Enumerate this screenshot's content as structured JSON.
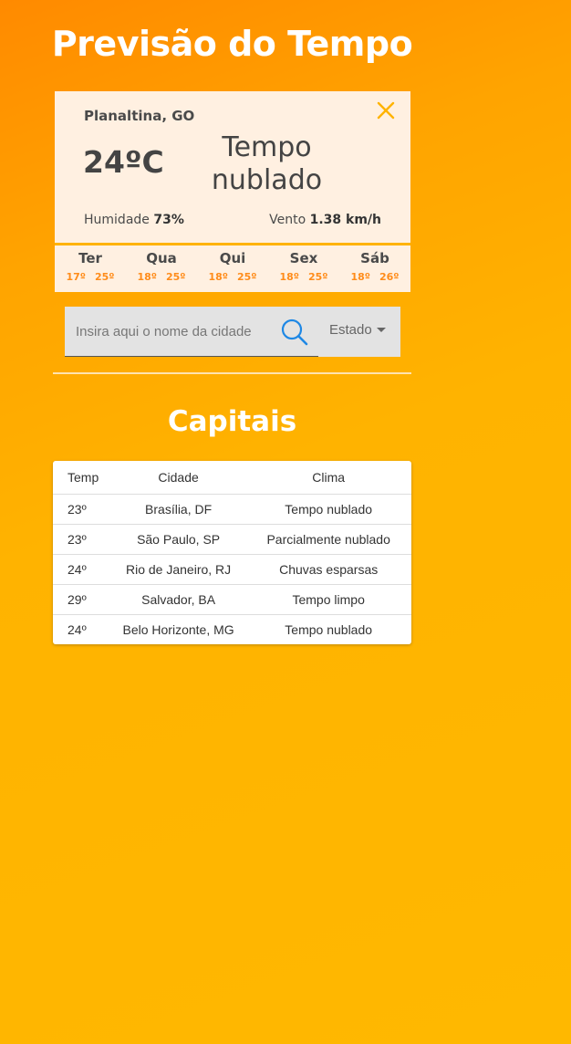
{
  "page": {
    "title": "Previsão do Tempo"
  },
  "weather": {
    "city": "Planaltina, GO",
    "temperature": "24ºC",
    "condition_line1": "Tempo",
    "condition_line2": "nublado",
    "humidity_label": "Humidade",
    "humidity_value": "73%",
    "wind_label": "Vento",
    "wind_value": "1.38 km/h",
    "forecast": [
      {
        "day": "Ter",
        "min": "17º",
        "max": "25º"
      },
      {
        "day": "Qua",
        "min": "18º",
        "max": "25º"
      },
      {
        "day": "Qui",
        "min": "18º",
        "max": "25º"
      },
      {
        "day": "Sex",
        "min": "18º",
        "max": "25º"
      },
      {
        "day": "Sáb",
        "min": "18º",
        "max": "26º"
      }
    ]
  },
  "search": {
    "placeholder": "Insira aqui o nome da cidade",
    "value": "",
    "state_label": "Estado"
  },
  "capitals": {
    "title": "Capitais",
    "headers": {
      "temp": "Temp",
      "city": "Cidade",
      "clima": "Clima"
    },
    "rows": [
      {
        "temp": "23º",
        "city": "Brasília, DF",
        "clima": "Tempo nublado"
      },
      {
        "temp": "23º",
        "city": "São Paulo, SP",
        "clima": "Parcialmente nublado"
      },
      {
        "temp": "24º",
        "city": "Rio de Janeiro, RJ",
        "clima": "Chuvas esparsas"
      },
      {
        "temp": "29º",
        "city": "Salvador, BA",
        "clima": "Tempo limpo"
      },
      {
        "temp": "24º",
        "city": "Belo Horizonte, MG",
        "clima": "Tempo nublado"
      }
    ]
  },
  "colors": {
    "background_top": "#ff8a00",
    "background_bottom": "#ffb800",
    "card_background": "#fff0e1",
    "forecast_accent": "#ff8c1a",
    "close_icon": "#ffb300",
    "search_icon": "#1e88e5"
  },
  "icons": {
    "close": "close-icon",
    "search": "search-icon",
    "dropdown": "caret-down-icon"
  }
}
